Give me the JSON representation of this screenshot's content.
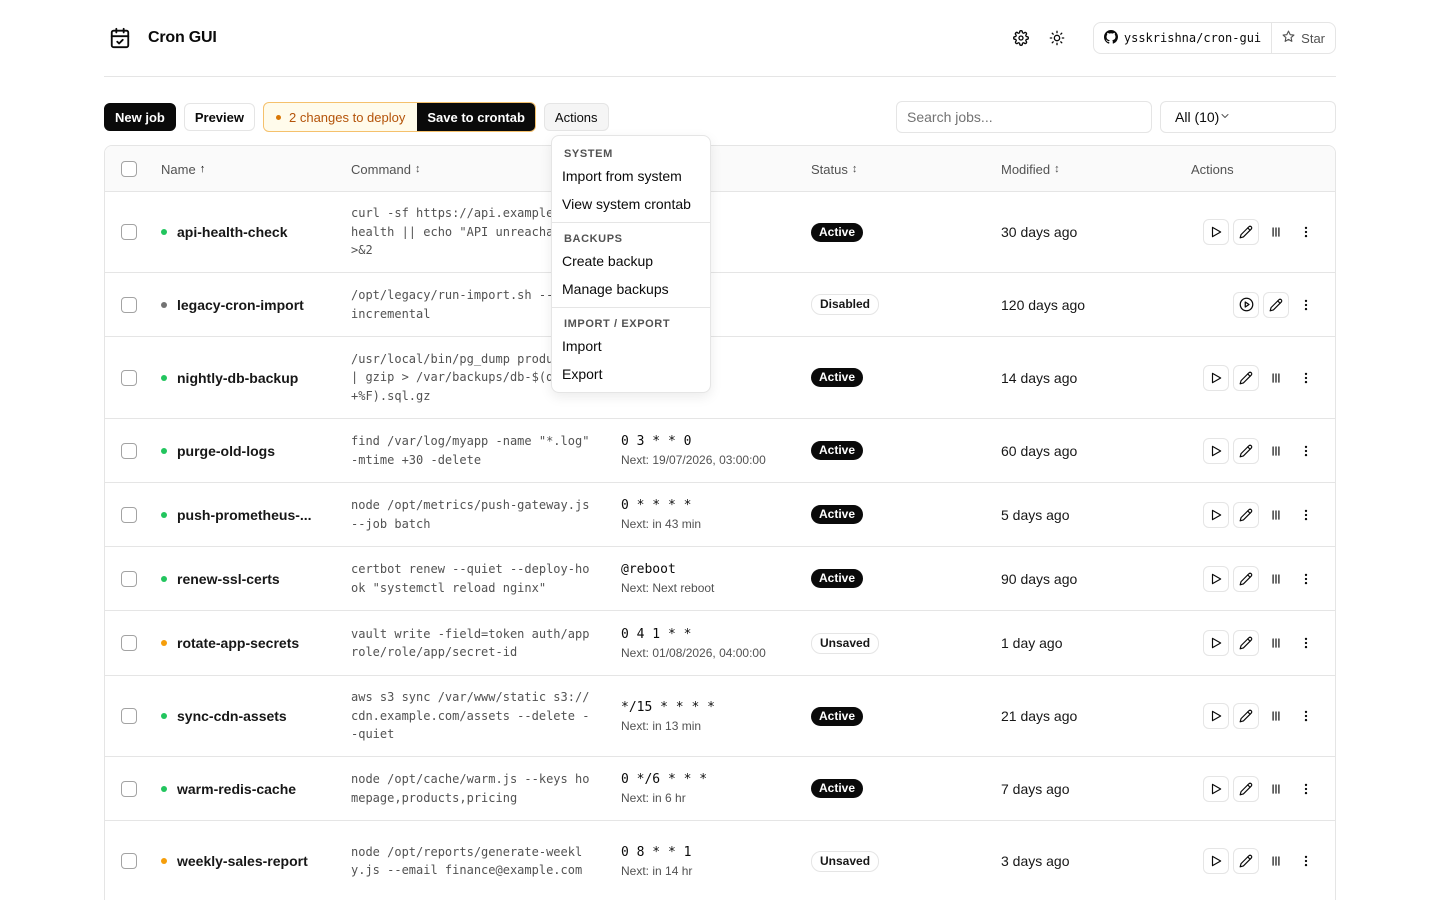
{
  "app": {
    "title": "Cron GUI",
    "github_repo": "ysskrishna/cron-gui",
    "star_label": "Star"
  },
  "toolbar": {
    "new_job": "New job",
    "preview": "Preview",
    "changes_to_deploy": "2 changes to deploy",
    "save_to_crontab": "Save to crontab",
    "actions": "Actions",
    "search_placeholder": "Search jobs...",
    "filter_value": "All (10)"
  },
  "table": {
    "headers": {
      "name": "Name",
      "command": "Command",
      "status": "Status",
      "modified": "Modified",
      "actions": "Actions"
    },
    "sort_indicators": {
      "name": "↑",
      "command": "↕",
      "status": "↕",
      "modified": "↕"
    },
    "rows": [
      {
        "name": "api-health-check",
        "dot_color": "#22c55e",
        "command": "curl -sf https://api.example.com/health || echo \"API unreachable\" >&2",
        "schedule": "",
        "next": "",
        "status": "Active",
        "modified": "30 days ago",
        "enabled": true
      },
      {
        "name": "legacy-cron-import",
        "dot_color": "#737373",
        "command": "/opt/legacy/run-import.sh --mode incremental",
        "schedule": "",
        "next": "",
        "status": "Disabled",
        "modified": "120 days ago",
        "enabled": false
      },
      {
        "name": "nightly-db-backup",
        "dot_color": "#22c55e",
        "command": "/usr/local/bin/pg_dump production | gzip > /var/backups/db-$(date +%F).sql.gz",
        "schedule": "",
        "next": "",
        "status": "Active",
        "modified": "14 days ago",
        "enabled": true
      },
      {
        "name": "purge-old-logs",
        "dot_color": "#22c55e",
        "command": "find /var/log/myapp -name \"*.log\" -mtime +30 -delete",
        "schedule": "0 3 * * 0",
        "next": "Next: 19/07/2026, 03:00:00",
        "status": "Active",
        "modified": "60 days ago",
        "enabled": true
      },
      {
        "name": "push-prometheus-...",
        "dot_color": "#22c55e",
        "command": "node /opt/metrics/push-gateway.js --job batch",
        "schedule": "0 * * * *",
        "next": "Next: in 43 min",
        "status": "Active",
        "modified": "5 days ago",
        "enabled": true
      },
      {
        "name": "renew-ssl-certs",
        "dot_color": "#22c55e",
        "command": "certbot renew --quiet --deploy-hook \"systemctl reload nginx\"",
        "schedule": "@reboot",
        "next": "Next: Next reboot",
        "status": "Active",
        "modified": "90 days ago",
        "enabled": true
      },
      {
        "name": "rotate-app-secrets",
        "dot_color": "#f59e0b",
        "command": "vault write -field=token auth/approle/role/app/secret-id",
        "schedule": "0 4 1 * *",
        "next": "Next: 01/08/2026, 04:00:00",
        "status": "Unsaved",
        "modified": "1 day ago",
        "enabled": true
      },
      {
        "name": "sync-cdn-assets",
        "dot_color": "#22c55e",
        "command": "aws s3 sync /var/www/static s3://cdn.example.com/assets --delete --quiet",
        "schedule": "*/15 * * * *",
        "next": "Next: in 13 min",
        "status": "Active",
        "modified": "21 days ago",
        "enabled": true
      },
      {
        "name": "warm-redis-cache",
        "dot_color": "#22c55e",
        "command": "node /opt/cache/warm.js --keys homepage,products,pricing",
        "schedule": "0 */6 * * *",
        "next": "Next: in 6 hr",
        "status": "Active",
        "modified": "7 days ago",
        "enabled": true
      },
      {
        "name": "weekly-sales-report",
        "dot_color": "#f59e0b",
        "command": "node /opt/reports/generate-weekly.js --email finance@example.com",
        "schedule": "0 8 * * 1",
        "next": "Next: in 14 hr",
        "status": "Unsaved",
        "modified": "3 days ago",
        "enabled": true
      }
    ]
  },
  "actions_menu": {
    "groups": [
      {
        "label": "SYSTEM",
        "items": [
          "Import from system",
          "View system crontab"
        ]
      },
      {
        "label": "BACKUPS",
        "items": [
          "Create backup",
          "Manage backups"
        ]
      },
      {
        "label": "IMPORT / EXPORT",
        "items": [
          "Import",
          "Export"
        ]
      }
    ]
  },
  "icons": {
    "logo": "calendar-check-icon",
    "settings": "gear-icon",
    "theme": "sun-icon",
    "github": "github-icon",
    "star": "star-icon",
    "run": "play-icon",
    "edit": "pencil-icon",
    "pause": "pause-icon",
    "more": "more-vertical-icon",
    "enable": "play-circle-icon"
  }
}
